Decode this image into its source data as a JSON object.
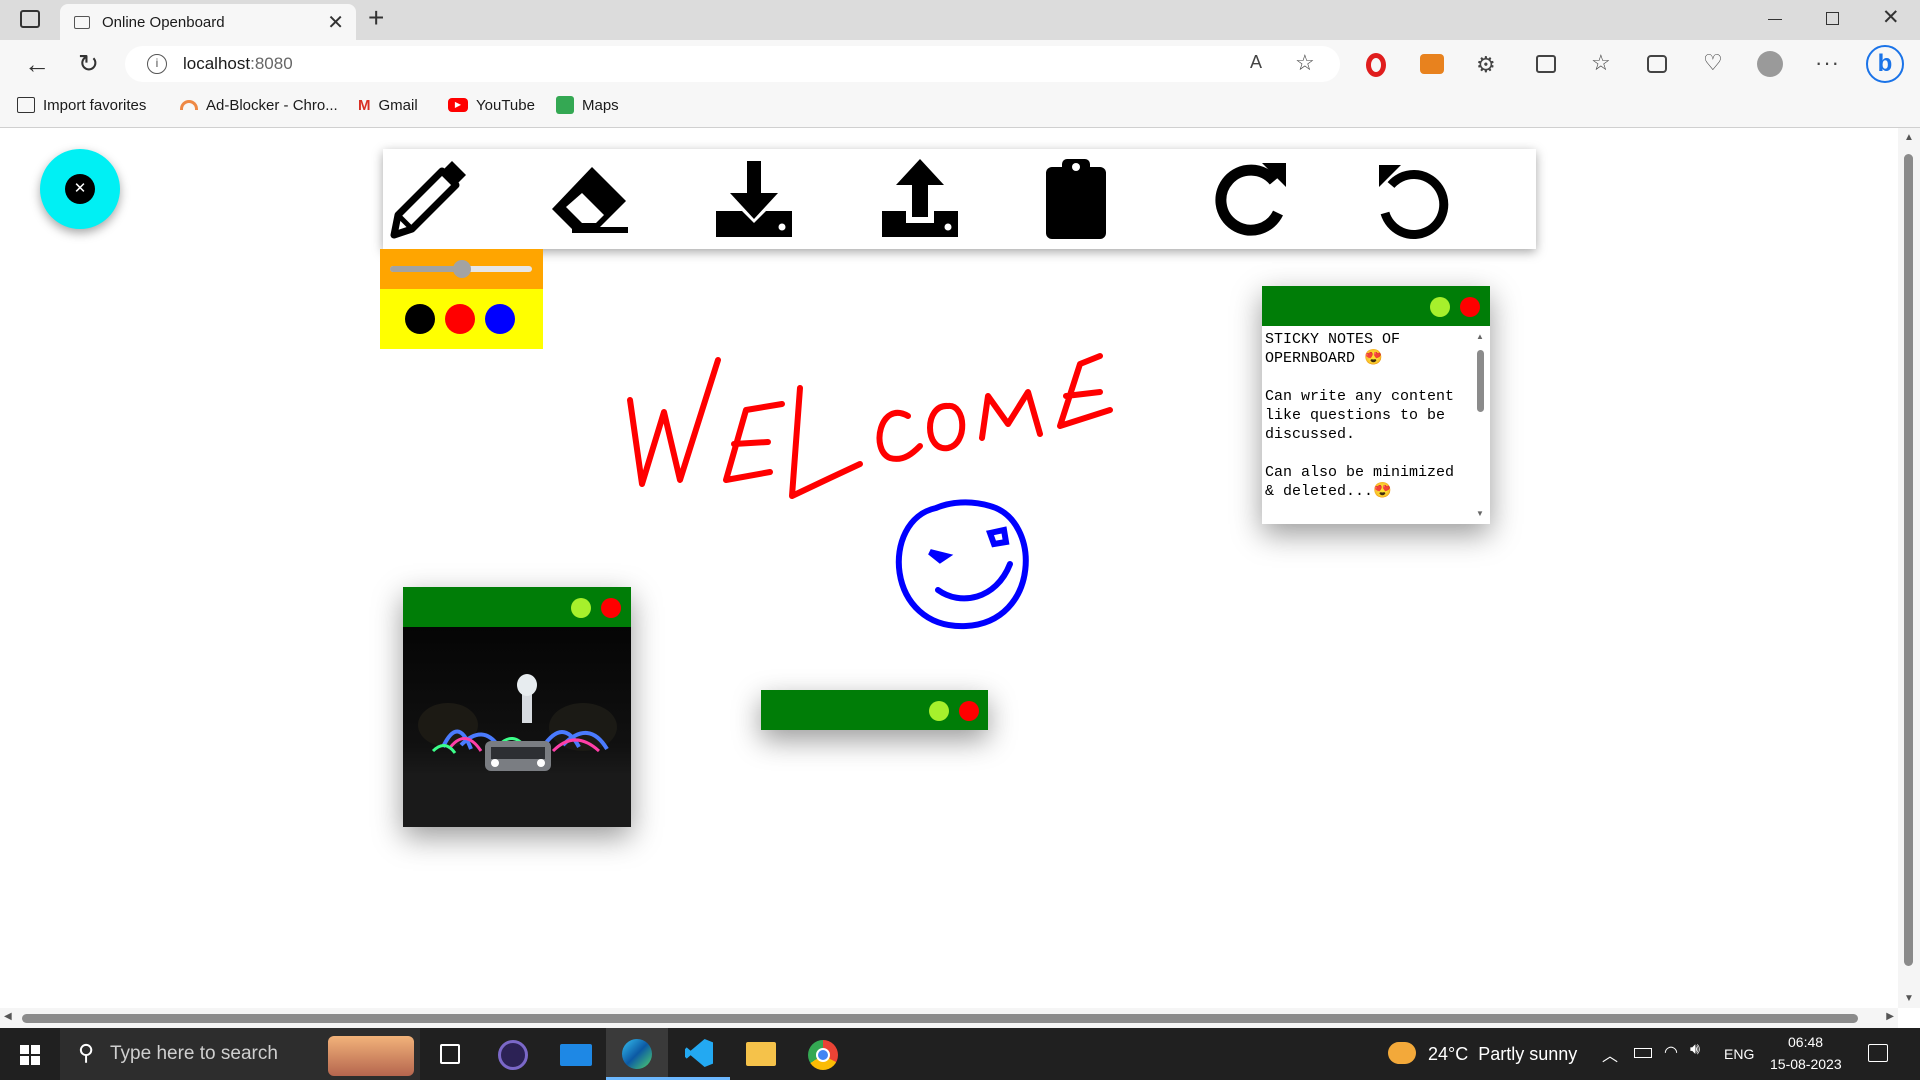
{
  "browser": {
    "tab_title": "Online Openboard",
    "url_host": "localhost",
    "url_port": ":8080",
    "favorites": [
      "Import favorites",
      "Ad-Blocker - Chro...",
      "Gmail",
      "YouTube",
      "Maps"
    ]
  },
  "toolbar": {
    "tools": [
      "pencil-icon",
      "eraser-icon",
      "download-icon",
      "upload-icon",
      "sticky-note-icon",
      "redo-icon",
      "undo-icon"
    ]
  },
  "pencil_panel": {
    "width_slider": 0.5,
    "colors": [
      "#000000",
      "#ff0000",
      "#0000ff"
    ]
  },
  "canvas": {
    "drawing_text": "WELCOME",
    "drawing_color": "#ff0000",
    "smiley_color": "#0000ff"
  },
  "sticky_notes": {
    "note1_text": "STICKY NOTES OF\nOPERNBOARD 😍\n\nCan write any content\nlike questions to be\ndiscussed.\n\nCan also be minimized\n& deleted...😍",
    "header_color": "#007d07",
    "minimize_color": "#a6f02c",
    "close_color": "#ff0000"
  },
  "taskbar": {
    "search_placeholder": "Type here to search",
    "weather": "24°C  Partly sunny",
    "language": "ENG",
    "time": "06:48",
    "date": "15-08-2023"
  }
}
